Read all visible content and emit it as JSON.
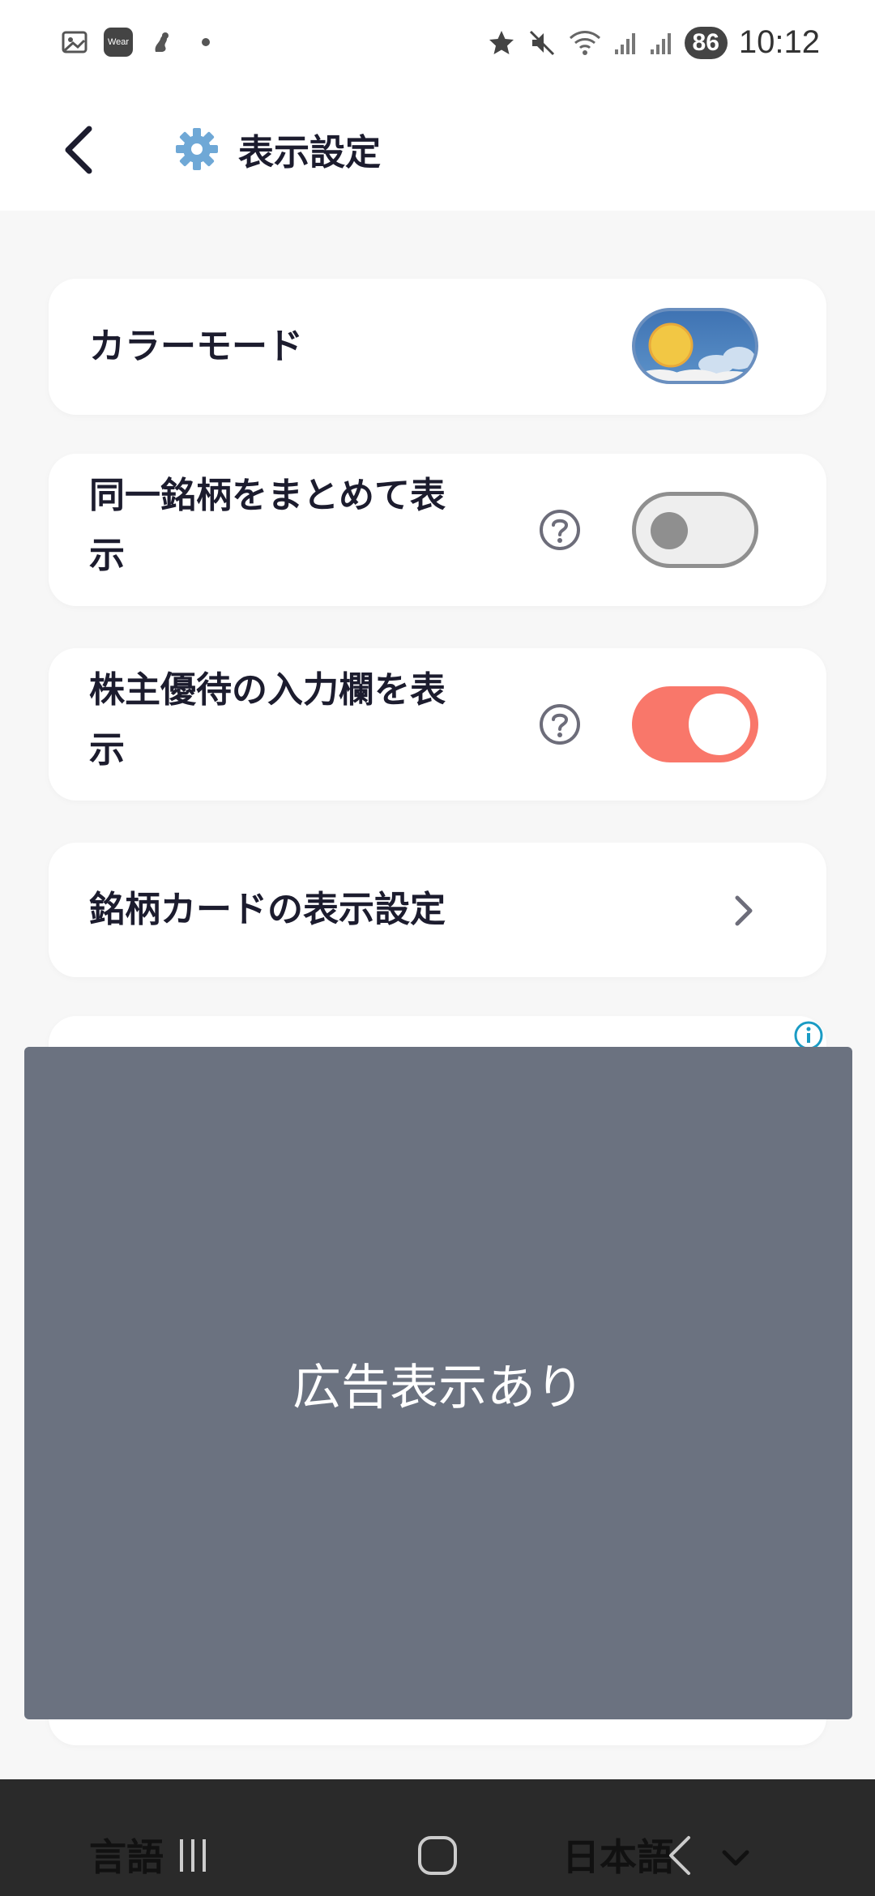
{
  "status_bar": {
    "time": "10:12",
    "battery": "86",
    "wear_label": "Wear",
    "left_icons": [
      "screenshot-icon",
      "wear-os-icon",
      "app-icon",
      "dot-icon"
    ],
    "right_icons": [
      "star-icon",
      "mute-icon",
      "wifi-icon",
      "signal-icon",
      "signal-icon"
    ]
  },
  "header": {
    "title": "表示設定",
    "icon": "gear-icon"
  },
  "settings": {
    "color_mode": {
      "label": "カラーモード",
      "state": "light"
    },
    "group_same_stock": {
      "label_line1": "同一銘柄をまとめて表",
      "label_line2": "示",
      "enabled": false
    },
    "shareholder_benefits": {
      "label_line1": "株主優待の入力欄を表",
      "label_line2": "示",
      "enabled": true
    },
    "stock_card_display": {
      "label": "銘柄カードの表示設定"
    }
  },
  "ad": {
    "text": "広告表示あり"
  },
  "language_row": {
    "label": "言語",
    "value": "日本語"
  },
  "colors": {
    "accent": "#f9776a",
    "ad_background": "#6b7280",
    "text": "#1c1c2e"
  }
}
